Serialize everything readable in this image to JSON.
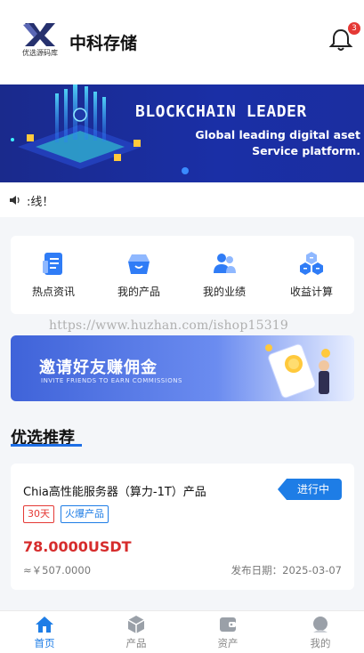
{
  "header": {
    "app_name": "中科存储",
    "logo_mark": "优选源码库",
    "notification_count": "3"
  },
  "banner": {
    "title": "BLOCKCHAIN LEADER",
    "subtitle": "Global leading digital aset Service platform."
  },
  "notice": {
    "text": ":线！"
  },
  "quick_links": [
    {
      "label": "热点资讯",
      "icon": "news-icon"
    },
    {
      "label": "我的产品",
      "icon": "basket-icon"
    },
    {
      "label": "我的业绩",
      "icon": "team-icon"
    },
    {
      "label": "收益计算",
      "icon": "calculator-icon"
    }
  ],
  "watermark": "https://www.huzhan.com/ishop15319",
  "invite": {
    "title": "邀请好友赚佣金",
    "subtitle": "INVITE FRIENDS TO EARN COMMISSIONS"
  },
  "section": {
    "title": "优选推荐"
  },
  "product": {
    "name": "Chia高性能服务器（算力-1T）产品",
    "status": "进行中",
    "tags": [
      "30天",
      "火爆产品"
    ],
    "price": "78.0000USDT",
    "approx": "≈￥507.0000",
    "publish_label": "发布日期：",
    "publish_date": "2025-03-07"
  },
  "tabbar": [
    {
      "label": "首页",
      "icon": "home-icon",
      "active": true
    },
    {
      "label": "产品",
      "icon": "cube-icon",
      "active": false
    },
    {
      "label": "资产",
      "icon": "wallet-icon",
      "active": false
    },
    {
      "label": "我的",
      "icon": "user-icon",
      "active": false
    }
  ],
  "colors": {
    "accent": "#1e7de6",
    "price": "#d62c2c",
    "banner_bg": "#1a2fa6"
  }
}
